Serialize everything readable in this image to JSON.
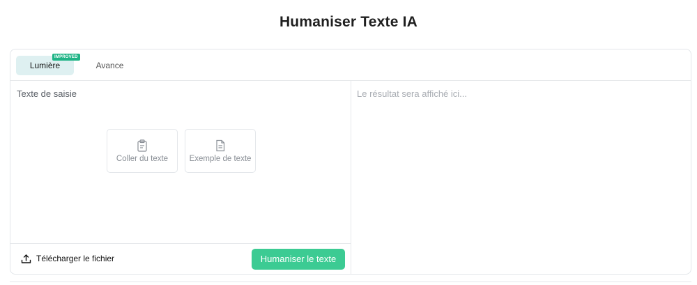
{
  "page": {
    "title": "Humaniser Texte IA"
  },
  "tabs": [
    {
      "label": "Lumière",
      "badge": "IMPROVED",
      "active": true
    },
    {
      "label": "Avance",
      "active": false
    }
  ],
  "input": {
    "label": "Texte de saisie",
    "actions": [
      {
        "label": "Coller du texte",
        "icon": "clipboard-icon"
      },
      {
        "label": "Exemple de texte",
        "icon": "document-icon"
      }
    ]
  },
  "footer": {
    "upload_label": "Télécharger le fichier",
    "upload_icon": "upload-icon",
    "submit_label": "Humaniser le texte"
  },
  "output": {
    "placeholder": "Le résultat sera affiché ici..."
  },
  "colors": {
    "accent": "#3ccb93",
    "badge": "#20b486",
    "active_tab": "#def0f1"
  }
}
